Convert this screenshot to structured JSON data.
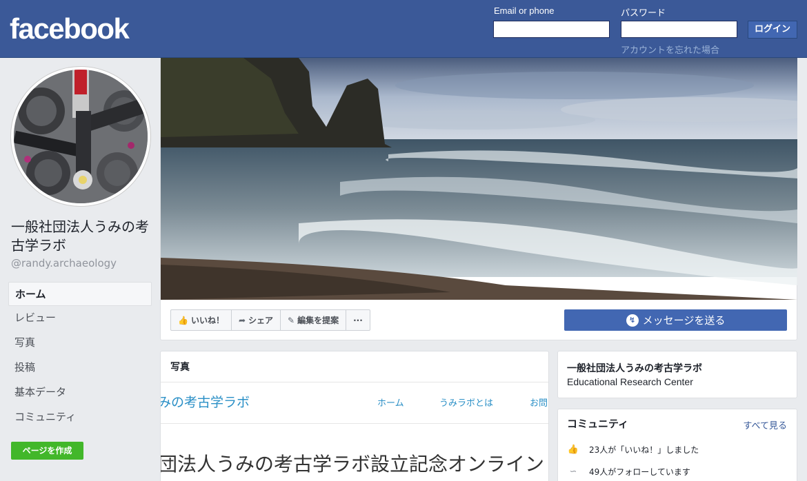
{
  "header": {
    "logo": "facebook",
    "email_label": "Email or phone",
    "password_label": "パスワード",
    "login_button": "ログイン",
    "forgot_link": "アカウントを忘れた場合"
  },
  "page": {
    "name": "一般社団法人うみの考古学ラボ",
    "handle": "@randy.archaeology"
  },
  "nav": {
    "items": [
      {
        "label": "ホーム",
        "active": true
      },
      {
        "label": "レビュー"
      },
      {
        "label": "写真"
      },
      {
        "label": "投稿"
      },
      {
        "label": "基本データ"
      },
      {
        "label": "コミュニティ"
      }
    ],
    "create_page": "ページを作成"
  },
  "actions": {
    "like": "いいね！",
    "share": "シェア",
    "suggest_edit": "編集を提案",
    "more": "···",
    "message": "メッセージを送る"
  },
  "photos": {
    "title": "写真",
    "preview": {
      "site_title": "みの考古学ラボ",
      "nav_home": "ホーム",
      "nav_about": "うみラボとは",
      "nav_contact": "お問",
      "headline": "団法人うみの考古学ラボ設立記念オンライン"
    }
  },
  "about": {
    "name": "一般社団法人うみの考古学ラボ",
    "category": "Educational Research Center"
  },
  "community": {
    "title": "コミュニティ",
    "see_all": "すべて見る",
    "likes": "23人が「いいね！」しました",
    "follows": "49人がフォローしています"
  },
  "colors": {
    "brand": "#3b5998",
    "button": "#4267b2",
    "create_page": "#42b72a",
    "link": "#365899"
  }
}
